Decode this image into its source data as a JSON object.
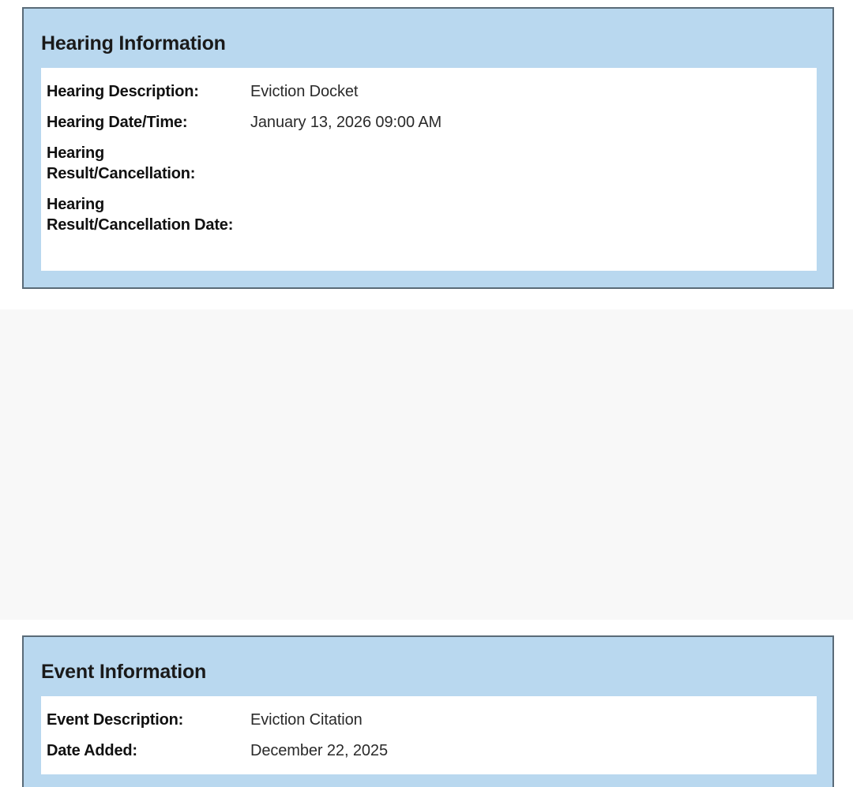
{
  "hearing": {
    "title": "Hearing Information",
    "rows": [
      {
        "label": "Hearing Description:",
        "value": "Eviction Docket"
      },
      {
        "label": "Hearing Date/Time:",
        "value": "January 13, 2026 09:00 AM"
      },
      {
        "label": "Hearing Result/Cancellation:",
        "value": ""
      },
      {
        "label": "Hearing Result/Cancellation Date:",
        "value": ""
      }
    ]
  },
  "event": {
    "title": "Event Information",
    "rows": [
      {
        "label": "Event Description:",
        "value": "Eviction Citation"
      },
      {
        "label": "Date Added:",
        "value": "December 22, 2025"
      }
    ]
  },
  "colors": {
    "panel_header": "#b9d8ef",
    "panel_border": "#5a6b78",
    "redacted_area": "#f8f8f8"
  }
}
